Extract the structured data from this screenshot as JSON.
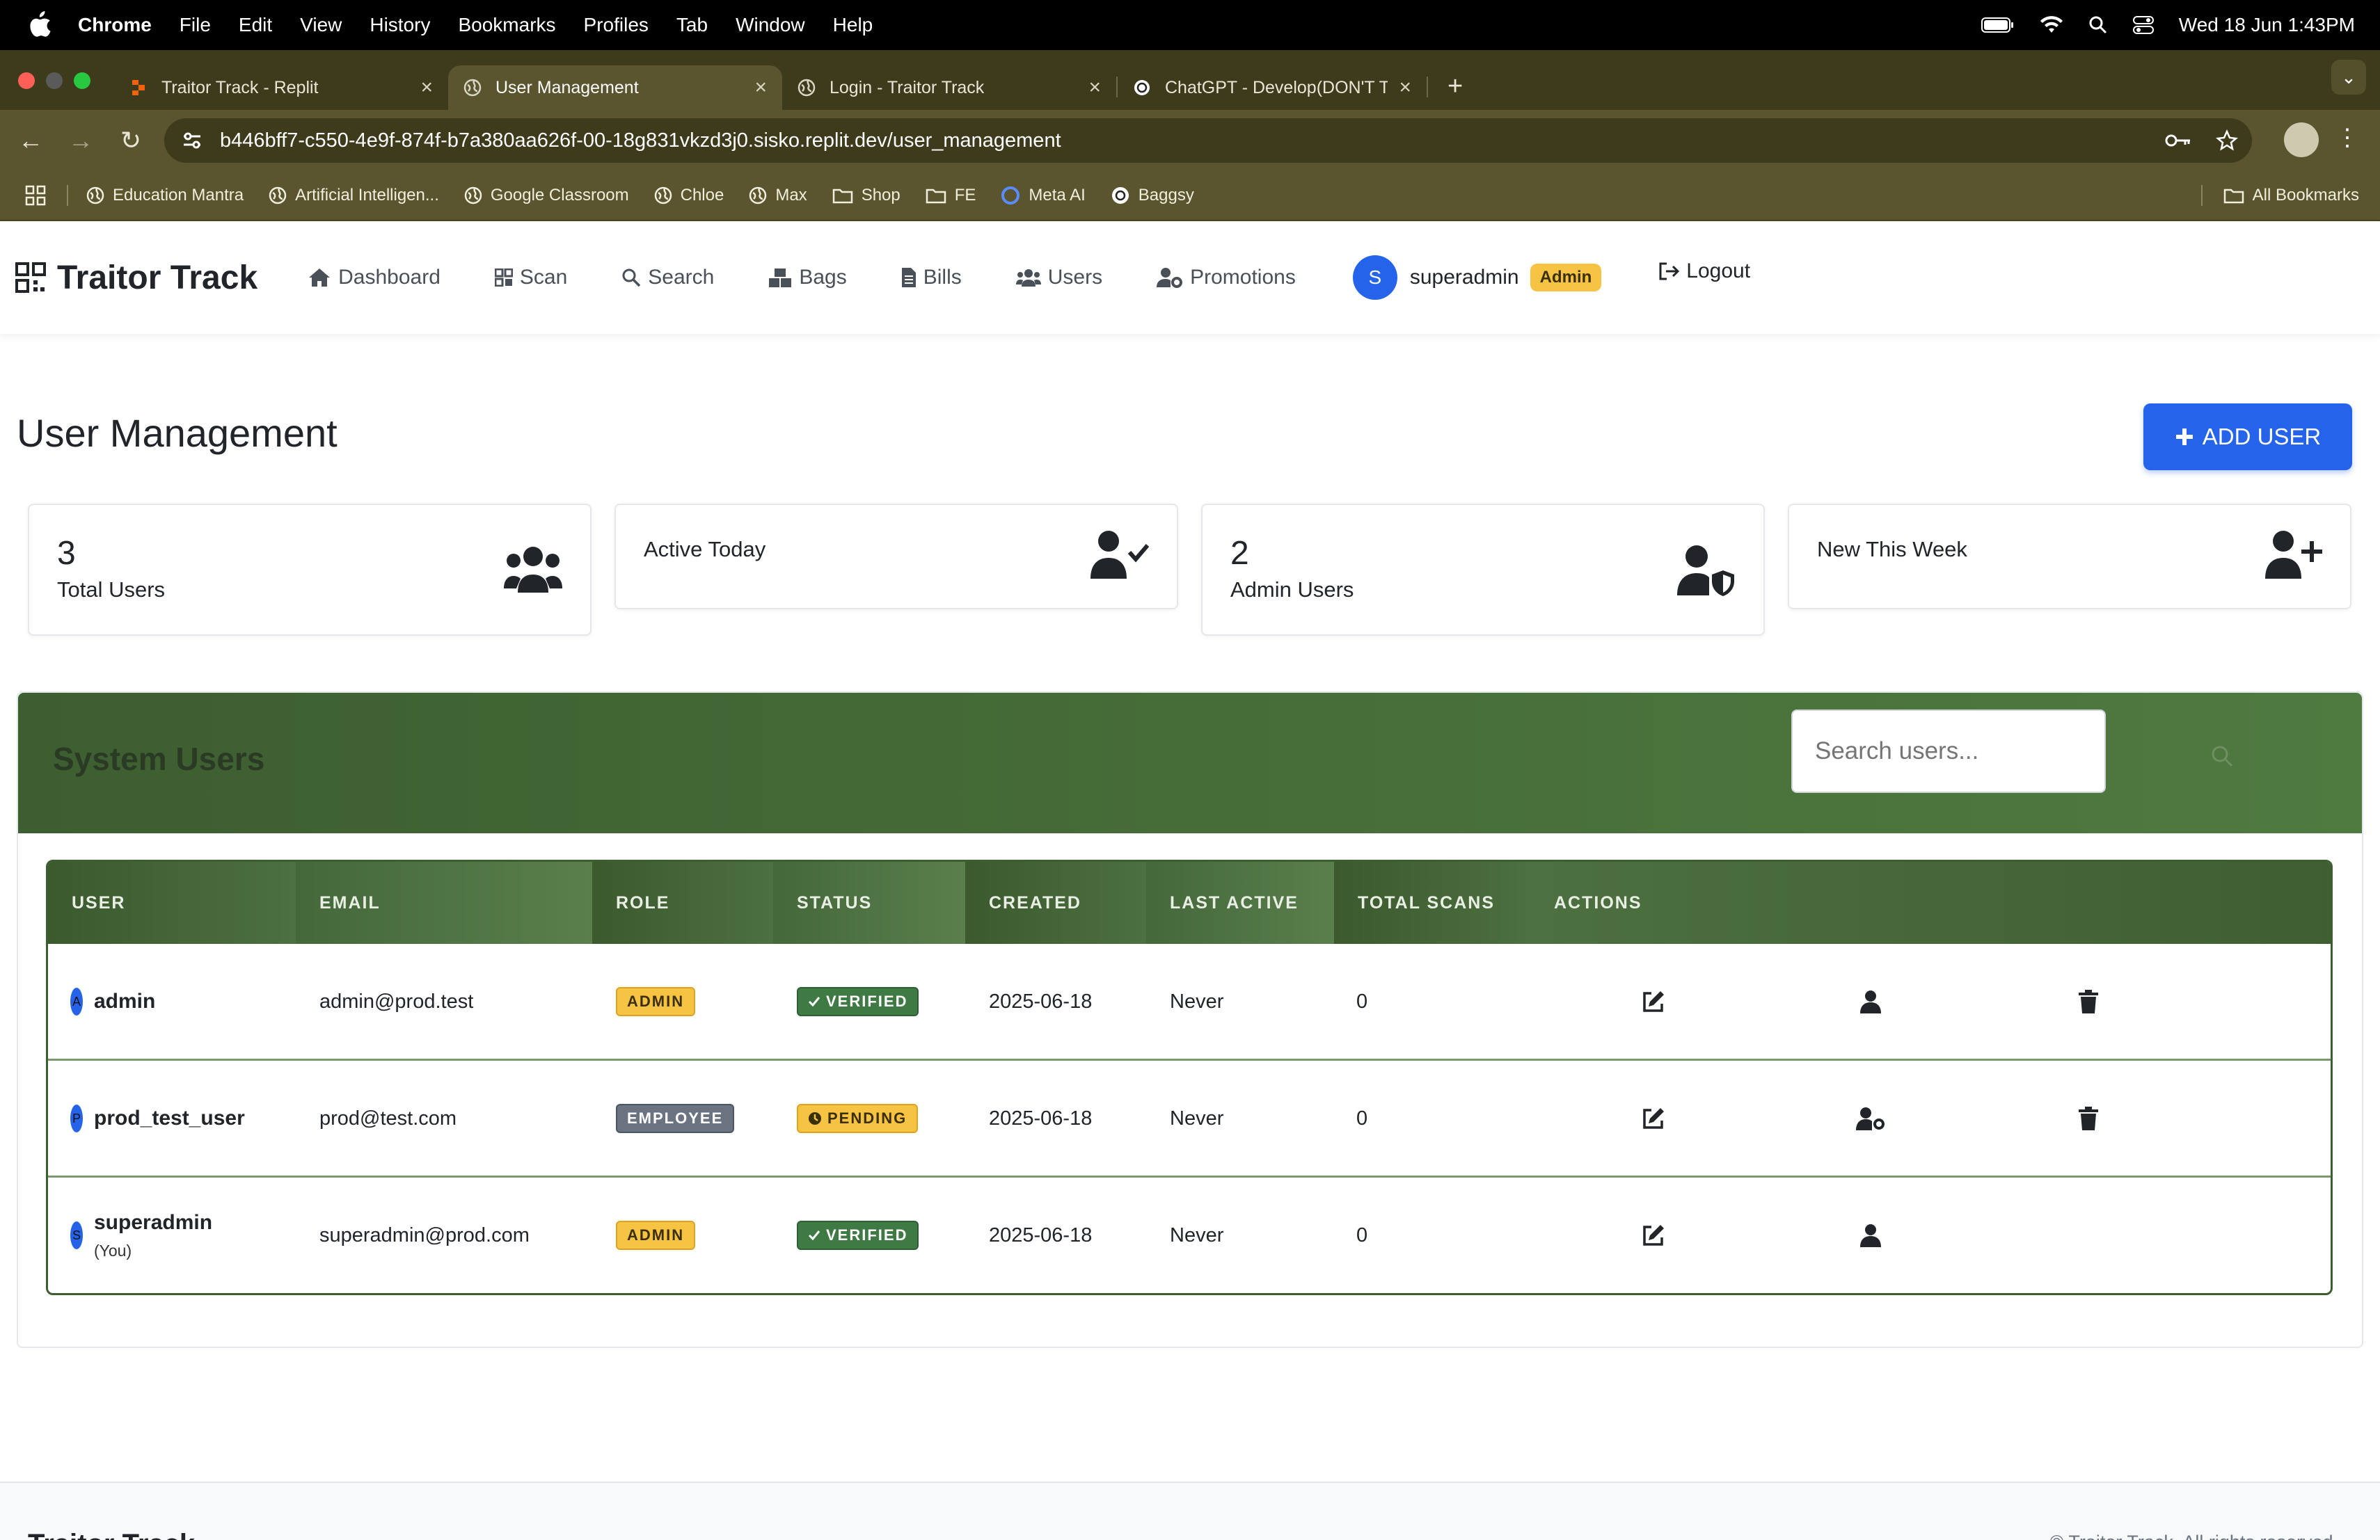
{
  "menubar": {
    "app": "Chrome",
    "items": [
      "File",
      "Edit",
      "View",
      "History",
      "Bookmarks",
      "Profiles",
      "Tab",
      "Window",
      "Help"
    ],
    "datetime": "Wed 18 Jun  1:43PM"
  },
  "tabs": [
    {
      "title": "Traitor Track - Replit",
      "active": false
    },
    {
      "title": "User Management",
      "active": true
    },
    {
      "title": "Login - Traitor Track",
      "active": false
    },
    {
      "title": "ChatGPT - Develop(DON'T T",
      "active": false
    }
  ],
  "address": {
    "url": "b446bff7-c550-4e9f-874f-b7a380aa626f-00-18g831vkzd3j0.sisko.replit.dev/user_management"
  },
  "bookmarks": {
    "items": [
      "Education Mantra",
      "Artificial Intelligen...",
      "Google Classroom",
      "Chloe",
      "Max",
      "Shop",
      "FE",
      "Meta AI",
      "Baggsy"
    ],
    "all": "All Bookmarks"
  },
  "nav": {
    "brand": "Traitor Track",
    "links": {
      "dashboard": "Dashboard",
      "scan": "Scan",
      "search": "Search",
      "bags": "Bags",
      "bills": "Bills",
      "users": "Users",
      "promotions": "Promotions"
    },
    "user": {
      "initial": "S",
      "name": "superadmin",
      "role_badge": "Admin"
    },
    "logout": "Logout"
  },
  "page": {
    "title": "User Management",
    "add_user": "ADD USER"
  },
  "stats": {
    "total": {
      "value": "3",
      "label": "Total Users"
    },
    "active": {
      "label": "Active Today"
    },
    "admins": {
      "value": "2",
      "label": "Admin Users"
    },
    "new_week": {
      "label": "New This Week"
    }
  },
  "users_panel": {
    "title": "System Users",
    "search_placeholder": "Search users...",
    "columns": {
      "user": "USER",
      "email": "EMAIL",
      "role": "ROLE",
      "status": "STATUS",
      "created": "CREATED",
      "last_active": "LAST ACTIVE",
      "total_scans": "TOTAL SCANS",
      "actions": "ACTIONS"
    },
    "rows": [
      {
        "initial": "A",
        "username": "admin",
        "you": "",
        "email": "admin@prod.test",
        "role": "ADMIN",
        "status": "VERIFIED",
        "created": "2025-06-18",
        "last_active": "Never",
        "scans": "0"
      },
      {
        "initial": "P",
        "username": "prod_test_user",
        "you": "",
        "email": "prod@test.com",
        "role": "EMPLOYEE",
        "status": "PENDING",
        "created": "2025-06-18",
        "last_active": "Never",
        "scans": "0"
      },
      {
        "initial": "S",
        "username": "superadmin",
        "you": "(You)",
        "email": "superadmin@prod.com",
        "role": "ADMIN",
        "status": "VERIFIED",
        "created": "2025-06-18",
        "last_active": "Never",
        "scans": "0"
      }
    ]
  },
  "footer": {
    "brand": "Traitor Track",
    "copy": "© Traitor Track. All rights reserved."
  },
  "colors": {
    "primary": "#2563eb",
    "panel_green": "#3f5f31",
    "admin_yellow": "#f6c343",
    "verified_green": "#3f7a45"
  }
}
